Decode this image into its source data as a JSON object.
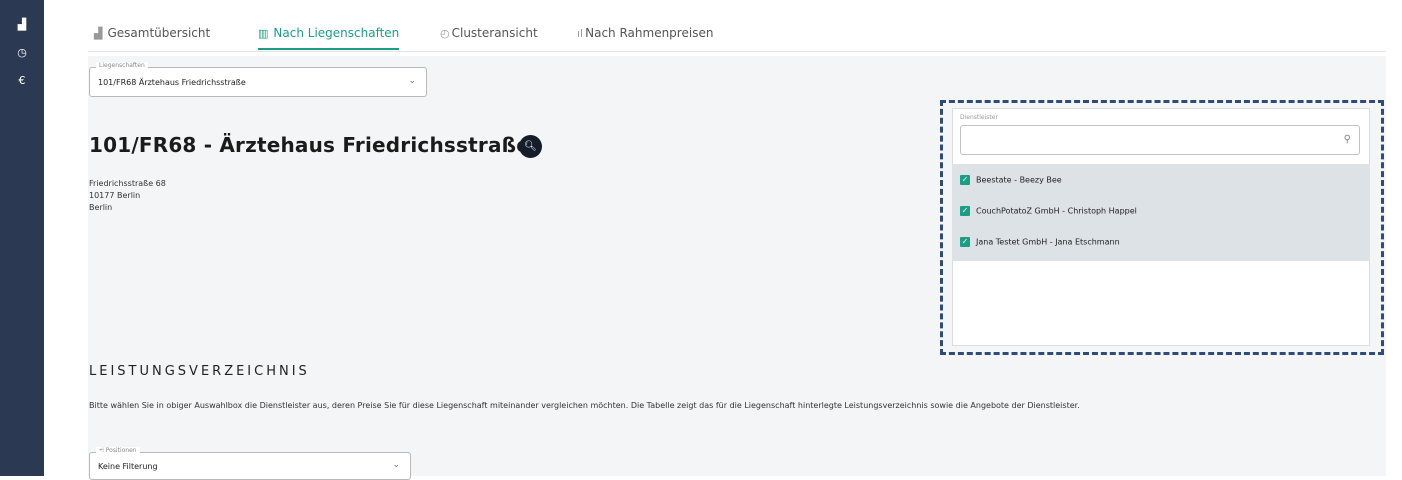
{
  "sidebar": {
    "items": [
      {
        "icon": "chart-icon",
        "glyph": "▟"
      },
      {
        "icon": "clock-icon",
        "glyph": "◷"
      },
      {
        "icon": "euro-icon",
        "glyph": "€"
      }
    ]
  },
  "tabs": [
    {
      "label": "Gesamtübersicht",
      "icon": "chart-icon",
      "glyph": "▟"
    },
    {
      "label": "Nach Liegenschaften",
      "icon": "building-icon",
      "glyph": "▥"
    },
    {
      "label": "Clusteransicht",
      "icon": "dashboard-icon",
      "glyph": "◴"
    },
    {
      "label": "Nach Rahmenpreisen",
      "icon": "bar-chart-icon",
      "glyph": "ıl"
    }
  ],
  "property_select": {
    "legend": "Liegenschaften",
    "value": "101/FR68 Ärztehaus Friedrichsstraße"
  },
  "property": {
    "title": "101/FR68 - Ärztehaus Friedrichsstraße",
    "address_line1": "Friedrichsstraße 68",
    "address_line2": "10177 Berlin",
    "address_line3": "Berlin"
  },
  "dienstleister": {
    "label": "Dienstleister",
    "search_placeholder": "",
    "items": [
      {
        "label": "Beestate - Beezy Bee",
        "checked": true
      },
      {
        "label": "CouchPotatoZ GmbH - Christoph Happel",
        "checked": true
      },
      {
        "label": "Jana Testet GmbH - Jana Etschmann",
        "checked": true
      }
    ]
  },
  "leistungsverzeichnis": {
    "title": "LEISTUNGSVERZEICHNIS",
    "description": "Bitte wählen Sie in obiger Auswahlbox die Dienstleister aus, deren Preise Sie für diese Liegenschaft miteinander vergleichen möchten. Die Tabelle zeigt das für die Liegenschaft hinterlegte Leistungsverzeichnis sowie die Angebote der Dienstleister."
  },
  "positions_select": {
    "legend": "Positionen",
    "value": "Keine Filterung"
  },
  "colors": {
    "accent": "#1a9e86",
    "sidebar": "#2b3a52",
    "highlight_border": "#2f4b7a"
  }
}
